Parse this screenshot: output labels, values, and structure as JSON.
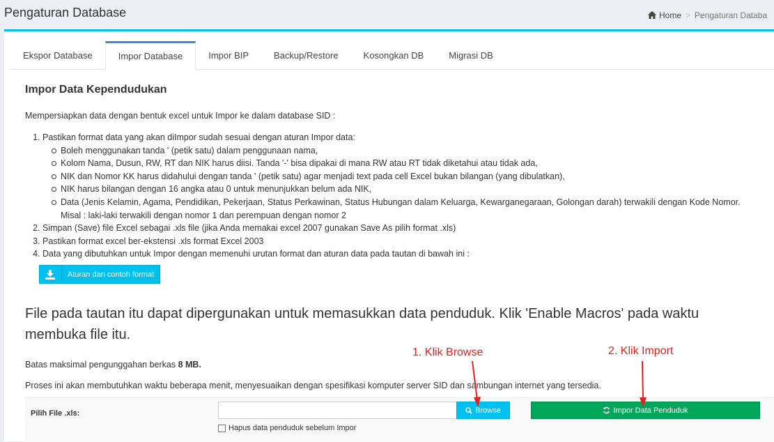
{
  "header": {
    "title": "Pengaturan Database",
    "breadcrumb": {
      "home": "Home",
      "current": "Pengaturan Databa"
    }
  },
  "tabs": [
    {
      "label": "Ekspor Database",
      "active": false
    },
    {
      "label": "Impor Database",
      "active": true
    },
    {
      "label": "Impor BIP",
      "active": false
    },
    {
      "label": "Backup/Restore",
      "active": false
    },
    {
      "label": "Kosongkan DB",
      "active": false
    },
    {
      "label": "Migrasi DB",
      "active": false
    }
  ],
  "section": {
    "title": "Impor Data Kependudukan",
    "intro": "Mempersiapkan data dengan bentuk excel untuk Impor ke dalam database SID :",
    "steps": [
      "Pastikan format data yang akan diImpor sudah sesuai dengan aturan Impor data:",
      "Simpan (Save) file Excel sebagai .xls file (jika Anda memakai excel 2007 gunakan Save As pilih format .xls)",
      "Pastikan format excel ber-ekstensi .xls format Excel 2003",
      "Data yang dibutuhkan untuk Impor dengan memenuhi urutan format dan aturan data pada tautan di bawah ini :"
    ],
    "substeps": [
      "Boleh menggunakan tanda ' (petik satu) dalam penggunaan nama,",
      "Kolom Nama, Dusun, RW, RT dan NIK harus diisi. Tanda '-' bisa dipakai di mana RW atau RT tidak diketahui atau tidak ada,",
      "NIK dan Nomor KK harus didahului dengan tanda ' (petik satu) agar menjadi text pada cell Excel bukan bilangan (yang dibulatkan),",
      "NIK harus bilangan dengan 16 angka atau 0 untuk menunjukkan belum ada NIK,",
      "Data (Jenis Kelamin, Agama, Pendidikan, Pekerjaan, Status Perkawinan, Status Hubungan dalam Keluarga, Kewarganegaraan, Golongan darah) terwakili dengan Kode Nomor."
    ],
    "substep_cont": "Misal : laki-laki terwakili dengan nomor 1 dan perempuan dengan nomor 2",
    "download_button": "Aturan dan contoh format",
    "big_text": "File pada tautan itu dapat dipergunakan untuk memasukkan data penduduk. Klik 'Enable Macros' pada waktu membuka file itu.",
    "limit_prefix": "Batas maksimal pengunggahan berkas ",
    "limit_value": "8 MB.",
    "process_text": "Proses ini akan membutuhkan waktu beberapa menit, menyesuaikan dengan spesifikasi komputer server SID dan sambungan internet yang tersedia."
  },
  "form": {
    "file_label": "Pilih File .xls:",
    "file_value": "",
    "browse_button": "Browse",
    "import_button": "Impor Data Penduduk",
    "checkbox_label": "Hapus data penduduk sebelum Impor",
    "checkbox_checked": false
  },
  "annotations": {
    "step1": "1. Klik Browse",
    "step2": "2. Klik Import",
    "color": "#e3211d"
  },
  "colors": {
    "primary": "#3c8dbc",
    "info": "#00c0ef",
    "success": "#00a65a",
    "background": "#ecf0f5"
  }
}
